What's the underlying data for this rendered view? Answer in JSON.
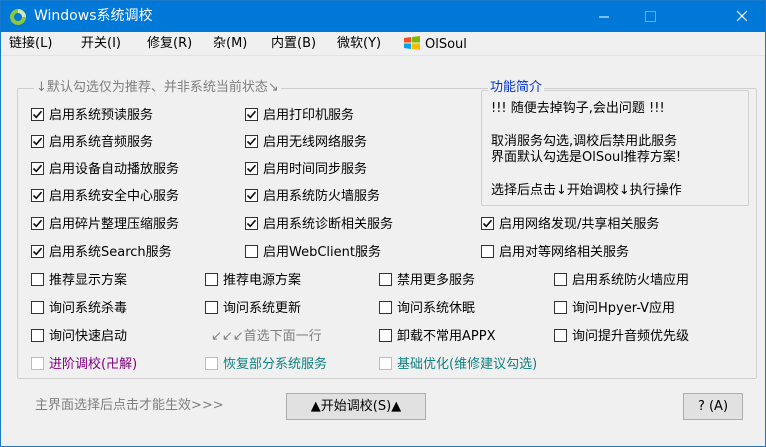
{
  "window": {
    "title": "Windows系统调校"
  },
  "title_controls": {
    "minimize": "—",
    "maximize": "☐",
    "close": "✕"
  },
  "menu": {
    "items": [
      "链接(L)",
      "开关(I)",
      "修复(R)",
      "杂(M)",
      "内置(B)",
      "微软(Y)"
    ],
    "brand": "OlSoul"
  },
  "main_group": {
    "legend": "↓默认勾选仅为推荐、并非系统当前状态↘"
  },
  "intro": {
    "legend": "功能简介",
    "line1": "!!! 随便去掉钩子,会出问题 !!!",
    "line2": "取消服务勾选,调校后禁用此服务",
    "line3": "界面默认勾选是OlSoul推荐方案!",
    "line4": "选择后点击↓开始调校↓执行操作"
  },
  "checks": {
    "c1": {
      "label": "启用系统预读服务",
      "checked": true
    },
    "c2": {
      "label": "启用打印机服务",
      "checked": true
    },
    "c3": {
      "label": "启用系统音频服务",
      "checked": true
    },
    "c4": {
      "label": "启用无线网络服务",
      "checked": true
    },
    "c5": {
      "label": "启用设备自动播放服务",
      "checked": true
    },
    "c6": {
      "label": "启用时间同步服务",
      "checked": true
    },
    "c7": {
      "label": "启用系统安全中心服务",
      "checked": true
    },
    "c8": {
      "label": "启用系统防火墙服务",
      "checked": true
    },
    "c9": {
      "label": "启用碎片整理压缩服务",
      "checked": true
    },
    "c10": {
      "label": "启用系统诊断相关服务",
      "checked": true
    },
    "c11": {
      "label": "启用网络发现/共享相关服务",
      "checked": true
    },
    "c12": {
      "label": "启用系统Search服务",
      "checked": true
    },
    "c13": {
      "label": "启用WebClient服务",
      "checked": false
    },
    "c14": {
      "label": "启用对等网络相关服务",
      "checked": false
    },
    "c15": {
      "label": "推荐显示方案",
      "checked": false
    },
    "c16": {
      "label": "推荐电源方案",
      "checked": false
    },
    "c17": {
      "label": "禁用更多服务",
      "checked": false
    },
    "c18": {
      "label": "启用系统防火墙应用",
      "checked": false
    },
    "c19": {
      "label": "询问系统杀毒",
      "checked": false
    },
    "c20": {
      "label": "询问系统更新",
      "checked": false
    },
    "c21": {
      "label": "询问系统休眠",
      "checked": false
    },
    "c22": {
      "label": "询问Hpyer-V应用",
      "checked": false
    },
    "c23": {
      "label": "询问快速启动",
      "checked": false
    },
    "c24": {
      "label": "卸载不常用APPX",
      "checked": false
    },
    "c25": {
      "label": "询问提升音频优先级",
      "checked": false
    },
    "c26": {
      "label": "进阶调校(卍解)",
      "checked": false
    },
    "c27": {
      "label": "恢复部分系统服务",
      "checked": false
    },
    "c28": {
      "label": "基础优化(维修建议勾选)",
      "checked": false
    }
  },
  "hint_select_next": "↙↙↙首选下面一行",
  "footer": {
    "note": "主界面选择后点击才能生效>>>",
    "start_button": "▲开始调校(S)▲",
    "help_button": "? (A)"
  },
  "colors": {
    "titlebar": "#0078d7",
    "purple": "#800080",
    "teal": "#108080"
  }
}
